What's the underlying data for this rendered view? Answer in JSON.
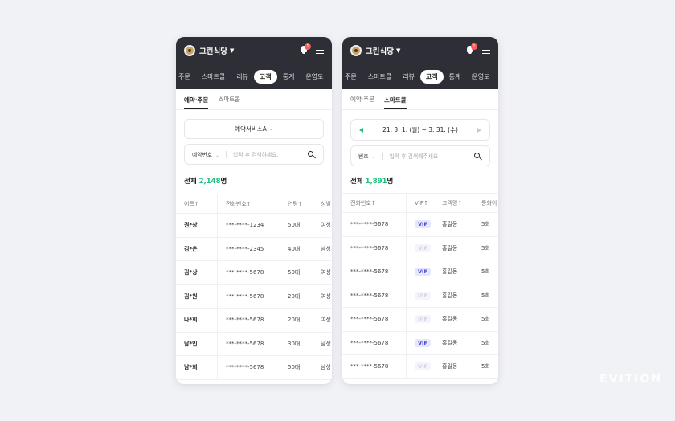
{
  "header": {
    "store_name": "그린식당",
    "notification_count": "1"
  },
  "nav_tabs": [
    "주문",
    "스마트콜",
    "리뷰",
    "고객",
    "통계",
    "운영도"
  ],
  "active_nav": "고객",
  "sub_tabs": [
    "예약·주문",
    "스마트콜"
  ],
  "panel_left": {
    "active_subtab": "예약·주문",
    "service_select": "예약서비스A",
    "search": {
      "type": "예약번호",
      "placeholder": "입력 후 검색하세요."
    },
    "total_label": "전체",
    "total_count": "2,148",
    "total_unit": "명",
    "columns": [
      "이름↑",
      "전화번호↑",
      "연령↑",
      "성별"
    ],
    "rows": [
      {
        "name": "권*상",
        "phone": "***-****-1234",
        "age": "50대",
        "gender": "여성"
      },
      {
        "name": "김*은",
        "phone": "***-****-2345",
        "age": "40대",
        "gender": "남성"
      },
      {
        "name": "김*상",
        "phone": "***-****-5678",
        "age": "50대",
        "gender": "여성"
      },
      {
        "name": "김*원",
        "phone": "***-****-5678",
        "age": "20대",
        "gender": "여성"
      },
      {
        "name": "나*희",
        "phone": "***-****-5678",
        "age": "20대",
        "gender": "여성"
      },
      {
        "name": "남*인",
        "phone": "***-****-5678",
        "age": "30대",
        "gender": "남성"
      },
      {
        "name": "남*희",
        "phone": "***-****-5678",
        "age": "50대",
        "gender": "남성"
      }
    ]
  },
  "panel_right": {
    "active_subtab": "스마트콜",
    "date_range": "21. 3. 1. (월) ~ 3. 31. (수)",
    "search": {
      "type": "번호",
      "placeholder": "입력 후 검색해주세요"
    },
    "total_label": "전체",
    "total_count": "1,891",
    "total_unit": "명",
    "columns": [
      "전화번호↑",
      "VIP↑",
      "고객명↑",
      "통화이"
    ],
    "vip_label": "VIP",
    "rows": [
      {
        "phone": "***-****-5678",
        "vip": true,
        "name": "홍길동",
        "calls": "5회"
      },
      {
        "phone": "***-****-5678",
        "vip": false,
        "name": "홍길동",
        "calls": "5회"
      },
      {
        "phone": "***-****-5678",
        "vip": true,
        "name": "홍길동",
        "calls": "5회"
      },
      {
        "phone": "***-****-5678",
        "vip": false,
        "name": "홍길동",
        "calls": "5회"
      },
      {
        "phone": "***-****-5678",
        "vip": false,
        "name": "홍길동",
        "calls": "5회"
      },
      {
        "phone": "***-****-5678",
        "vip": true,
        "name": "홍길동",
        "calls": "5회"
      },
      {
        "phone": "***-****-5678",
        "vip": false,
        "name": "홍길동",
        "calls": "5회"
      }
    ]
  },
  "watermark": "EVITION",
  "colors": {
    "topbar": "#2e2f36",
    "accent": "#1fbf7a",
    "vip": "#3f3fd0",
    "badge": "#ff5a5a"
  }
}
